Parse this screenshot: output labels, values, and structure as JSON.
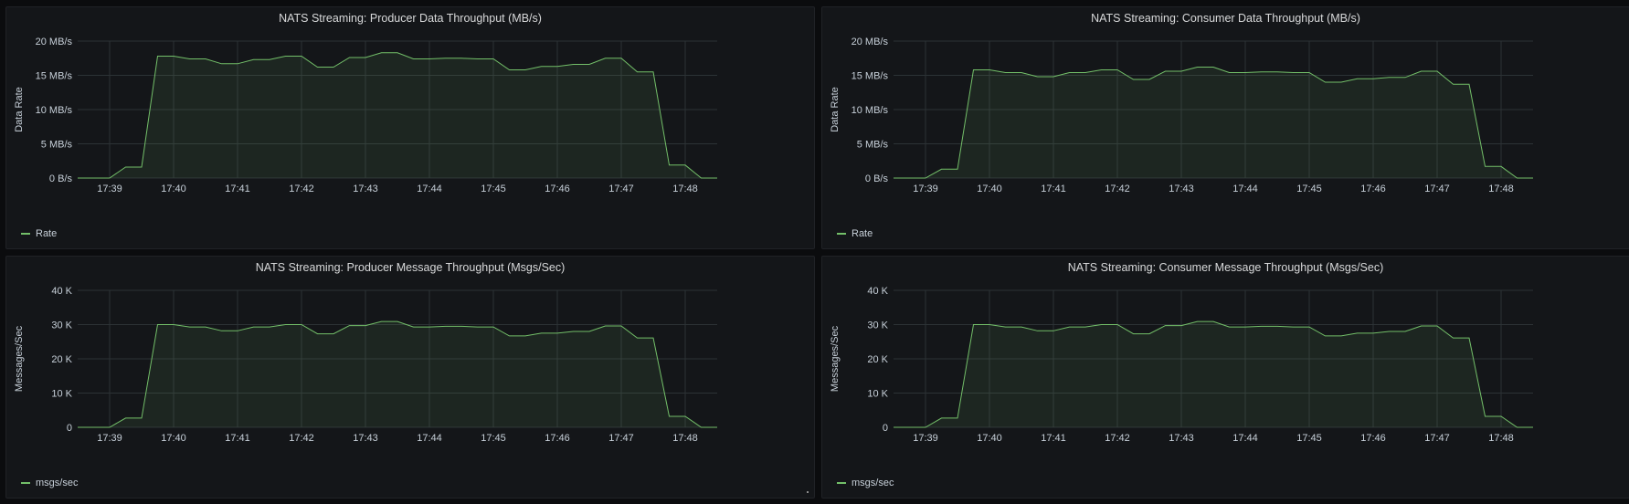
{
  "colors": {
    "series": "#73bf69",
    "grid": "#2c3235",
    "fill": "#73bf69"
  },
  "chart_data": [
    {
      "type": "area",
      "title": "NATS Streaming: Producer Data Throughput (MB/s)",
      "ylabel": "Data Rate",
      "ylim": [
        0,
        20
      ],
      "yticks": [
        0,
        5,
        10,
        15,
        20
      ],
      "ytick_labels": [
        "0 B/s",
        "5 MB/s",
        "10 MB/s",
        "15 MB/s",
        "20 MB/s"
      ],
      "xlim": [
        "17:38:30",
        "17:48:30"
      ],
      "xtick_labels": [
        "17:39",
        "17:40",
        "17:41",
        "17:42",
        "17:43",
        "17:44",
        "17:45",
        "17:46",
        "17:47",
        "17:48"
      ],
      "legend": [
        "Rate"
      ],
      "series": [
        {
          "name": "Rate",
          "x": [
            "17:38:30",
            "17:38:45",
            "17:39:00",
            "17:39:15",
            "17:39:30",
            "17:39:45",
            "17:40:00",
            "17:40:15",
            "17:40:30",
            "17:40:45",
            "17:41:00",
            "17:41:15",
            "17:41:30",
            "17:41:45",
            "17:42:00",
            "17:42:15",
            "17:42:30",
            "17:42:45",
            "17:43:00",
            "17:43:15",
            "17:43:30",
            "17:43:45",
            "17:44:00",
            "17:44:15",
            "17:44:30",
            "17:44:45",
            "17:45:00",
            "17:45:15",
            "17:45:30",
            "17:45:45",
            "17:46:00",
            "17:46:15",
            "17:46:30",
            "17:46:45",
            "17:47:00",
            "17:47:15",
            "17:47:30",
            "17:47:45",
            "17:48:00",
            "17:48:15",
            "17:48:30"
          ],
          "values": [
            0,
            0,
            0,
            1.6,
            1.6,
            17.8,
            17.8,
            17.4,
            17.4,
            16.7,
            16.7,
            17.3,
            17.3,
            17.8,
            17.8,
            16.2,
            16.2,
            17.6,
            17.6,
            18.3,
            18.3,
            17.4,
            17.4,
            17.5,
            17.5,
            17.4,
            17.4,
            15.8,
            15.8,
            16.3,
            16.3,
            16.6,
            16.6,
            17.5,
            17.5,
            15.5,
            15.5,
            1.9,
            1.9,
            0,
            0
          ]
        }
      ]
    },
    {
      "type": "area",
      "title": "NATS Streaming: Consumer Data Throughput (MB/s)",
      "ylabel": "Data Rate",
      "ylim": [
        0,
        20
      ],
      "yticks": [
        0,
        5,
        10,
        15,
        20
      ],
      "ytick_labels": [
        "0 B/s",
        "5 MB/s",
        "10 MB/s",
        "15 MB/s",
        "20 MB/s"
      ],
      "xlim": [
        "17:38:30",
        "17:48:30"
      ],
      "xtick_labels": [
        "17:39",
        "17:40",
        "17:41",
        "17:42",
        "17:43",
        "17:44",
        "17:45",
        "17:46",
        "17:47",
        "17:48"
      ],
      "legend": [
        "Rate"
      ],
      "series": [
        {
          "name": "Rate",
          "x": [
            "17:38:30",
            "17:38:45",
            "17:39:00",
            "17:39:15",
            "17:39:30",
            "17:39:45",
            "17:40:00",
            "17:40:15",
            "17:40:30",
            "17:40:45",
            "17:41:00",
            "17:41:15",
            "17:41:30",
            "17:41:45",
            "17:42:00",
            "17:42:15",
            "17:42:30",
            "17:42:45",
            "17:43:00",
            "17:43:15",
            "17:43:30",
            "17:43:45",
            "17:44:00",
            "17:44:15",
            "17:44:30",
            "17:44:45",
            "17:45:00",
            "17:45:15",
            "17:45:30",
            "17:45:45",
            "17:46:00",
            "17:46:15",
            "17:46:30",
            "17:46:45",
            "17:47:00",
            "17:47:15",
            "17:47:30",
            "17:47:45",
            "17:48:00",
            "17:48:15",
            "17:48:30"
          ],
          "values": [
            0,
            0,
            0,
            1.3,
            1.3,
            15.8,
            15.8,
            15.4,
            15.4,
            14.8,
            14.8,
            15.4,
            15.4,
            15.8,
            15.8,
            14.4,
            14.4,
            15.6,
            15.6,
            16.2,
            16.2,
            15.4,
            15.4,
            15.5,
            15.5,
            15.4,
            15.4,
            14.0,
            14.0,
            14.5,
            14.5,
            14.7,
            14.7,
            15.6,
            15.6,
            13.7,
            13.7,
            1.7,
            1.7,
            0,
            0
          ]
        }
      ]
    },
    {
      "type": "area",
      "title": "NATS Streaming: Producer Message Throughput (Msgs/Sec)",
      "ylabel": "Messages/Sec",
      "ylim": [
        0,
        40000
      ],
      "yticks": [
        0,
        10000,
        20000,
        30000,
        40000
      ],
      "ytick_labels": [
        "0",
        "10 K",
        "20 K",
        "30 K",
        "40 K"
      ],
      "xlim": [
        "17:38:30",
        "17:48:30"
      ],
      "xtick_labels": [
        "17:39",
        "17:40",
        "17:41",
        "17:42",
        "17:43",
        "17:44",
        "17:45",
        "17:46",
        "17:47",
        "17:48"
      ],
      "legend": [
        "msgs/sec"
      ],
      "series": [
        {
          "name": "msgs/sec",
          "x": [
            "17:38:30",
            "17:38:45",
            "17:39:00",
            "17:39:15",
            "17:39:30",
            "17:39:45",
            "17:40:00",
            "17:40:15",
            "17:40:30",
            "17:40:45",
            "17:41:00",
            "17:41:15",
            "17:41:30",
            "17:41:45",
            "17:42:00",
            "17:42:15",
            "17:42:30",
            "17:42:45",
            "17:43:00",
            "17:43:15",
            "17:43:30",
            "17:43:45",
            "17:44:00",
            "17:44:15",
            "17:44:30",
            "17:44:45",
            "17:45:00",
            "17:45:15",
            "17:45:30",
            "17:45:45",
            "17:46:00",
            "17:46:15",
            "17:46:30",
            "17:46:45",
            "17:47:00",
            "17:47:15",
            "17:47:30",
            "17:47:45",
            "17:48:00",
            "17:48:15",
            "17:48:30"
          ],
          "values": [
            0,
            0,
            0,
            2700,
            2700,
            30000,
            30000,
            29300,
            29300,
            28200,
            28200,
            29300,
            29300,
            30000,
            30000,
            27300,
            27300,
            29700,
            29700,
            30900,
            30900,
            29300,
            29300,
            29500,
            29500,
            29300,
            29300,
            26700,
            26700,
            27500,
            27500,
            28000,
            28000,
            29600,
            29600,
            26100,
            26100,
            3200,
            3200,
            0,
            0
          ]
        }
      ]
    },
    {
      "type": "area",
      "title": "NATS Streaming: Consumer Message Throughput (Msgs/Sec)",
      "ylabel": "Messages/Sec",
      "ylim": [
        0,
        40000
      ],
      "yticks": [
        0,
        10000,
        20000,
        30000,
        40000
      ],
      "ytick_labels": [
        "0",
        "10 K",
        "20 K",
        "30 K",
        "40 K"
      ],
      "xlim": [
        "17:38:30",
        "17:48:30"
      ],
      "xtick_labels": [
        "17:39",
        "17:40",
        "17:41",
        "17:42",
        "17:43",
        "17:44",
        "17:45",
        "17:46",
        "17:47",
        "17:48"
      ],
      "legend": [
        "msgs/sec"
      ],
      "series": [
        {
          "name": "msgs/sec",
          "x": [
            "17:38:30",
            "17:38:45",
            "17:39:00",
            "17:39:15",
            "17:39:30",
            "17:39:45",
            "17:40:00",
            "17:40:15",
            "17:40:30",
            "17:40:45",
            "17:41:00",
            "17:41:15",
            "17:41:30",
            "17:41:45",
            "17:42:00",
            "17:42:15",
            "17:42:30",
            "17:42:45",
            "17:43:00",
            "17:43:15",
            "17:43:30",
            "17:43:45",
            "17:44:00",
            "17:44:15",
            "17:44:30",
            "17:44:45",
            "17:45:00",
            "17:45:15",
            "17:45:30",
            "17:45:45",
            "17:46:00",
            "17:46:15",
            "17:46:30",
            "17:46:45",
            "17:47:00",
            "17:47:15",
            "17:47:30",
            "17:47:45",
            "17:48:00",
            "17:48:15",
            "17:48:30"
          ],
          "values": [
            0,
            0,
            0,
            2700,
            2700,
            30000,
            30000,
            29300,
            29300,
            28200,
            28200,
            29300,
            29300,
            30000,
            30000,
            27300,
            27300,
            29700,
            29700,
            30900,
            30900,
            29300,
            29300,
            29500,
            29500,
            29300,
            29300,
            26700,
            26700,
            27500,
            27500,
            28000,
            28000,
            29600,
            29600,
            26100,
            26100,
            3200,
            3200,
            0,
            0
          ]
        }
      ]
    }
  ]
}
